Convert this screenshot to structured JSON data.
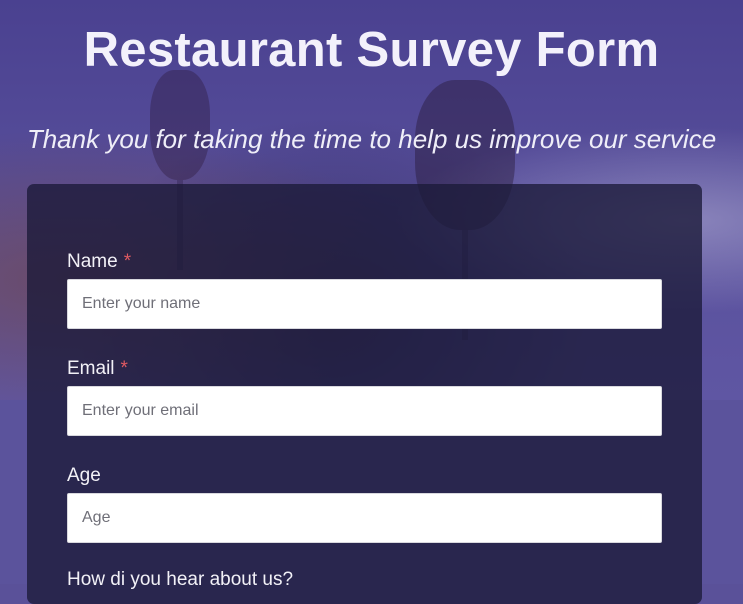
{
  "page": {
    "title": "Restaurant Survey Form",
    "description": "Thank you for taking the time to help us improve our service"
  },
  "form": {
    "name": {
      "label": "Name",
      "required_mark": "*",
      "placeholder": "Enter your name",
      "value": ""
    },
    "email": {
      "label": "Email",
      "required_mark": "*",
      "placeholder": "Enter your email",
      "value": ""
    },
    "age": {
      "label": "Age",
      "placeholder": "Age",
      "value": ""
    },
    "referral": {
      "label": "How di you hear about us?"
    }
  },
  "colors": {
    "accent_background": "#5a5199",
    "card_background": "#1b1938",
    "required": "#e05a62"
  }
}
